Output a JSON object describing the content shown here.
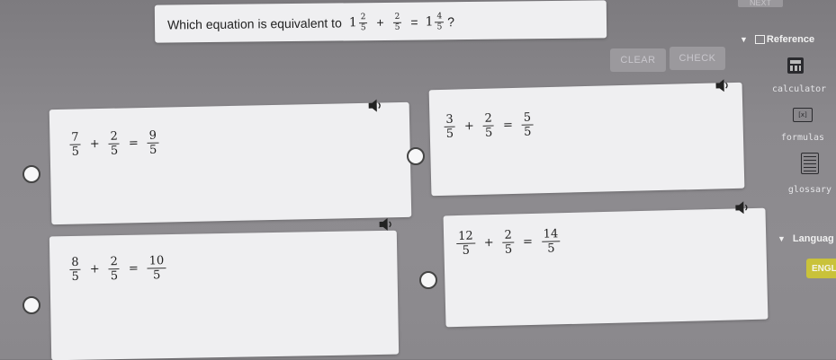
{
  "top": {
    "next_label": "NEXT"
  },
  "question": {
    "text": "Which equation is equivalent to",
    "lhs_whole": "1",
    "lhs_num": "2",
    "lhs_den": "5",
    "plus": "+",
    "add_num": "2",
    "add_den": "5",
    "equals": "=",
    "rhs_whole": "1",
    "rhs_num": "4",
    "rhs_den": "5",
    "end": "?"
  },
  "toolbar": {
    "clear_label": "CLEAR",
    "check_label": "CHECK"
  },
  "options": [
    {
      "a_num": "7",
      "a_den": "5",
      "b_num": "2",
      "b_den": "5",
      "c_num": "9",
      "c_den": "5"
    },
    {
      "a_num": "3",
      "a_den": "5",
      "b_num": "2",
      "b_den": "5",
      "c_num": "5",
      "c_den": "5"
    },
    {
      "a_num": "8",
      "a_den": "5",
      "b_num": "2",
      "b_den": "5",
      "c_num": "10",
      "c_den": "5"
    },
    {
      "a_num": "12",
      "a_den": "5",
      "b_num": "2",
      "b_den": "5",
      "c_num": "14",
      "c_den": "5"
    }
  ],
  "ops": {
    "plus": "+",
    "equals": "="
  },
  "reference": {
    "title": "Reference",
    "items": [
      {
        "label": "calculator",
        "icon": "calculator-icon"
      },
      {
        "label": "formulas",
        "icon": "formulas-icon"
      },
      {
        "label": "glossary",
        "icon": "glossary-icon"
      }
    ]
  },
  "language": {
    "title": "Languag",
    "value": "ENGL"
  },
  "colors": {
    "accent_yellow": "#c9c23a",
    "panel": "#efeff1"
  }
}
